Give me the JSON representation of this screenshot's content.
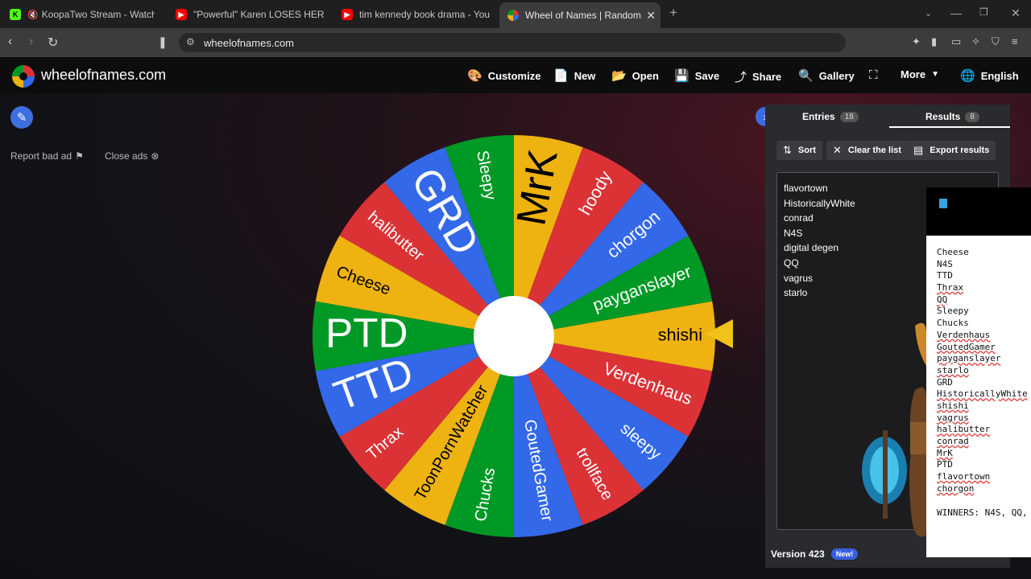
{
  "browser": {
    "tabs": [
      {
        "title": "KoopaTwo Stream - Watch Live o",
        "favicon": "kick-icon",
        "color": "#53fc18"
      },
      {
        "title": "\"Powerful\" Karen LOSES HER MIND W",
        "favicon": "youtube-icon",
        "color": "#ff0000"
      },
      {
        "title": "tim kennedy book drama - YouTube",
        "favicon": "youtube-icon",
        "color": "#ff0000"
      },
      {
        "title": "Wheel of Names | Random name",
        "favicon": "wheel-icon",
        "color": "#3369e8"
      }
    ],
    "url": "wheelofnames.com"
  },
  "site": {
    "title": "wheelofnames.com",
    "nav": {
      "customize": "Customize",
      "new": "New",
      "open": "Open",
      "save": "Save",
      "share": "Share",
      "gallery": "Gallery",
      "more": "More",
      "language": "English"
    },
    "report_ad": "Report bad ad",
    "close_ads": "Close ads"
  },
  "wheel": {
    "segments": [
      {
        "label": "shishi",
        "color": "#eeb211",
        "size": 16
      },
      {
        "label": "Verdenhaus",
        "color": "#db3236",
        "size": 16
      },
      {
        "label": "sleepy",
        "color": "#3369e8",
        "size": 15
      },
      {
        "label": "trollface",
        "color": "#db3236",
        "size": 15
      },
      {
        "label": "GoutedGamer",
        "color": "#3369e8",
        "size": 15
      },
      {
        "label": "Chucks",
        "color": "#009925",
        "size": 15
      },
      {
        "label": "ToonPornWatcher",
        "color": "#eeb211",
        "size": 15
      },
      {
        "label": "Thrax",
        "color": "#db3236",
        "size": 15
      },
      {
        "label": "TTD",
        "color": "#3369e8",
        "size": 38
      },
      {
        "label": "PTD",
        "color": "#009925",
        "size": 38
      },
      {
        "label": "Cheese",
        "color": "#eeb211",
        "size": 15
      },
      {
        "label": "halibutter",
        "color": "#db3236",
        "size": 15
      },
      {
        "label": "GRD",
        "color": "#3369e8",
        "size": 38
      },
      {
        "label": "Sleepy",
        "color": "#009925",
        "size": 15
      },
      {
        "label": "MrK",
        "color": "#eeb211",
        "size": 38
      },
      {
        "label": "hoody",
        "color": "#db3236",
        "size": 16
      },
      {
        "label": "chorgon",
        "color": "#3369e8",
        "size": 16
      },
      {
        "label": "payganslayer",
        "color": "#009925",
        "size": 16
      }
    ]
  },
  "panel": {
    "entries_label": "Entries",
    "entries_count": "18",
    "results_label": "Results",
    "results_count": "8",
    "sort": "Sort",
    "clear": "Clear the list",
    "export": "Export results",
    "results": [
      "flavortown",
      "HistoricallyWhite",
      "conrad",
      "N4S",
      "digital degen",
      "QQ",
      "vagrus",
      "starlo"
    ],
    "version": "Version 423",
    "new_badge": "New!"
  },
  "overlay": {
    "names": [
      {
        "t": "Cheese",
        "u": false
      },
      {
        "t": "N4S",
        "u": false
      },
      {
        "t": "TTD",
        "u": false
      },
      {
        "t": "Thrax",
        "u": true
      },
      {
        "t": "QQ",
        "u": true
      },
      {
        "t": "Sleepy",
        "u": false
      },
      {
        "t": "Chucks",
        "u": false
      },
      {
        "t": "Verdenhaus",
        "u": true
      },
      {
        "t": "GoutedGamer",
        "u": true
      },
      {
        "t": "payganslayer",
        "u": true
      },
      {
        "t": "starlo",
        "u": true
      },
      {
        "t": "GRD",
        "u": false
      },
      {
        "t": "HistoricallyWhite",
        "u": true
      },
      {
        "t": "shishi",
        "u": true
      },
      {
        "t": "vagrus",
        "u": true
      },
      {
        "t": "halibutter",
        "u": true
      },
      {
        "t": "conrad",
        "u": true
      },
      {
        "t": "MrK",
        "u": true
      },
      {
        "t": "PTD",
        "u": false
      },
      {
        "t": "flavortown",
        "u": true
      },
      {
        "t": "chorgon",
        "u": true
      }
    ],
    "winners": "WINNERS: N4S, QQ,"
  }
}
